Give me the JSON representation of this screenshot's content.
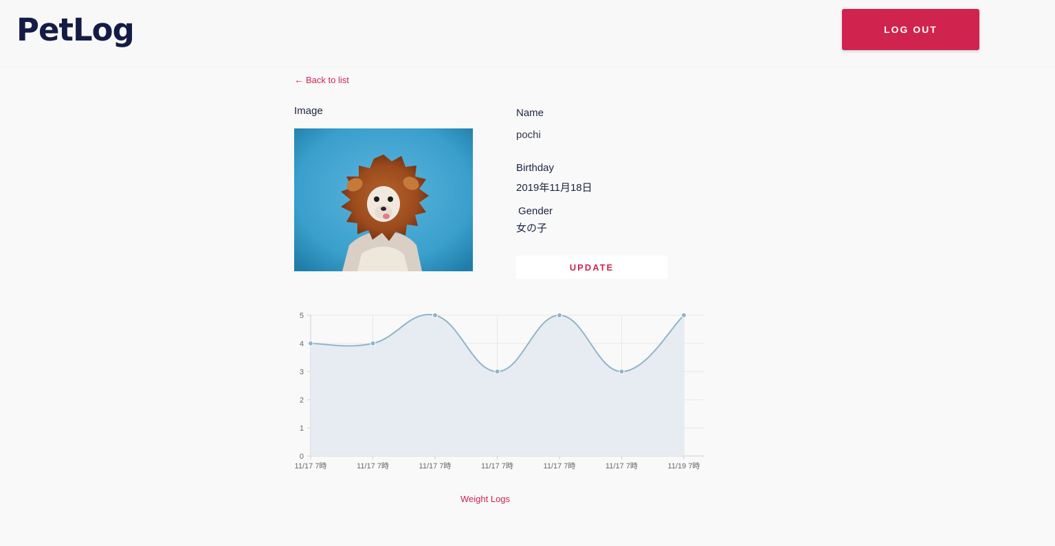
{
  "header": {
    "logo": "PetLog",
    "logout_label": "LOG OUT"
  },
  "nav": {
    "back_arrow": "←",
    "back_label": "Back to list"
  },
  "pet": {
    "image_label": "Image",
    "image_icon": "dog-in-lion-mane-photo",
    "name_label": "Name",
    "name_value": "pochi",
    "birthday_label": "Birthday",
    "birthday_value": "2019年11月18日",
    "gender_label": "Gender",
    "gender_value": "女の子",
    "update_label": "UPDATE"
  },
  "chart_data": {
    "type": "area",
    "categories": [
      "11/17 7時",
      "11/17 7時",
      "11/17 7時",
      "11/17 7時",
      "11/17 7時",
      "11/17 7時",
      "11/19 7時"
    ],
    "series": [
      {
        "values": [
          4,
          4,
          5,
          3,
          5,
          3,
          5
        ]
      }
    ],
    "yticks": [
      "0",
      "1",
      "2",
      "3",
      "4",
      "5"
    ],
    "ylim": [
      0,
      5
    ],
    "grid": true,
    "line_color": "#8fb4c9",
    "fill_color": "#e3eaf1"
  },
  "footer": {
    "weight_logs_label": "Weight Logs"
  },
  "colors": {
    "accent": "#d0234e",
    "logo": "#141c46",
    "background": "#f9f9fa"
  }
}
